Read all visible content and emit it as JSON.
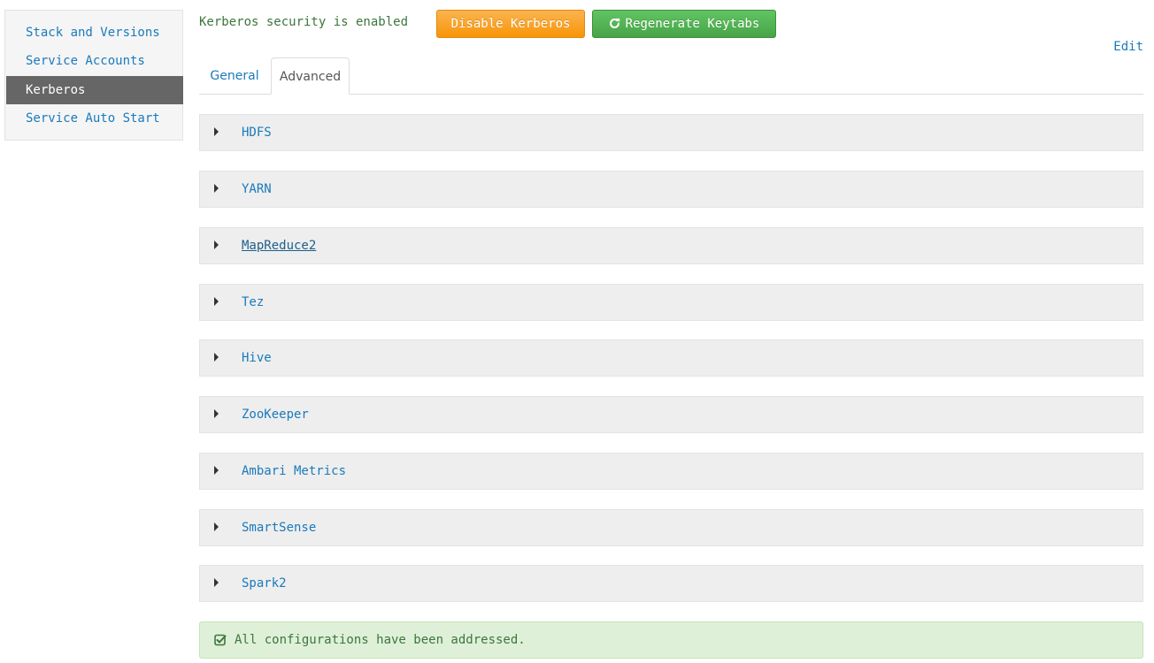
{
  "sidebar": {
    "items": [
      {
        "label": "Stack and Versions",
        "active": false
      },
      {
        "label": "Service Accounts",
        "active": false
      },
      {
        "label": "Kerberos",
        "active": true
      },
      {
        "label": "Service Auto Start",
        "active": false
      }
    ]
  },
  "header": {
    "status_text": "Kerberos security is enabled",
    "disable_button": "Disable Kerberos",
    "regenerate_button": "Regenerate Keytabs",
    "edit_link": "Edit"
  },
  "tabs": [
    {
      "label": "General",
      "active": false
    },
    {
      "label": "Advanced",
      "active": true
    }
  ],
  "panels": [
    {
      "label": "HDFS"
    },
    {
      "label": "YARN"
    },
    {
      "label": "MapReduce2"
    },
    {
      "label": "Tez"
    },
    {
      "label": "Hive"
    },
    {
      "label": "ZooKeeper"
    },
    {
      "label": "Ambari Metrics"
    },
    {
      "label": "SmartSense"
    },
    {
      "label": "Spark2"
    }
  ],
  "alert": {
    "text": "All configurations have been addressed.",
    "icon": "check-square-icon"
  },
  "colors": {
    "link": "#1a7abb",
    "active_sidebar": "#666666",
    "warning_button": "#f89406",
    "success_button": "#47a447",
    "success_alert_bg": "#dff0d8"
  }
}
